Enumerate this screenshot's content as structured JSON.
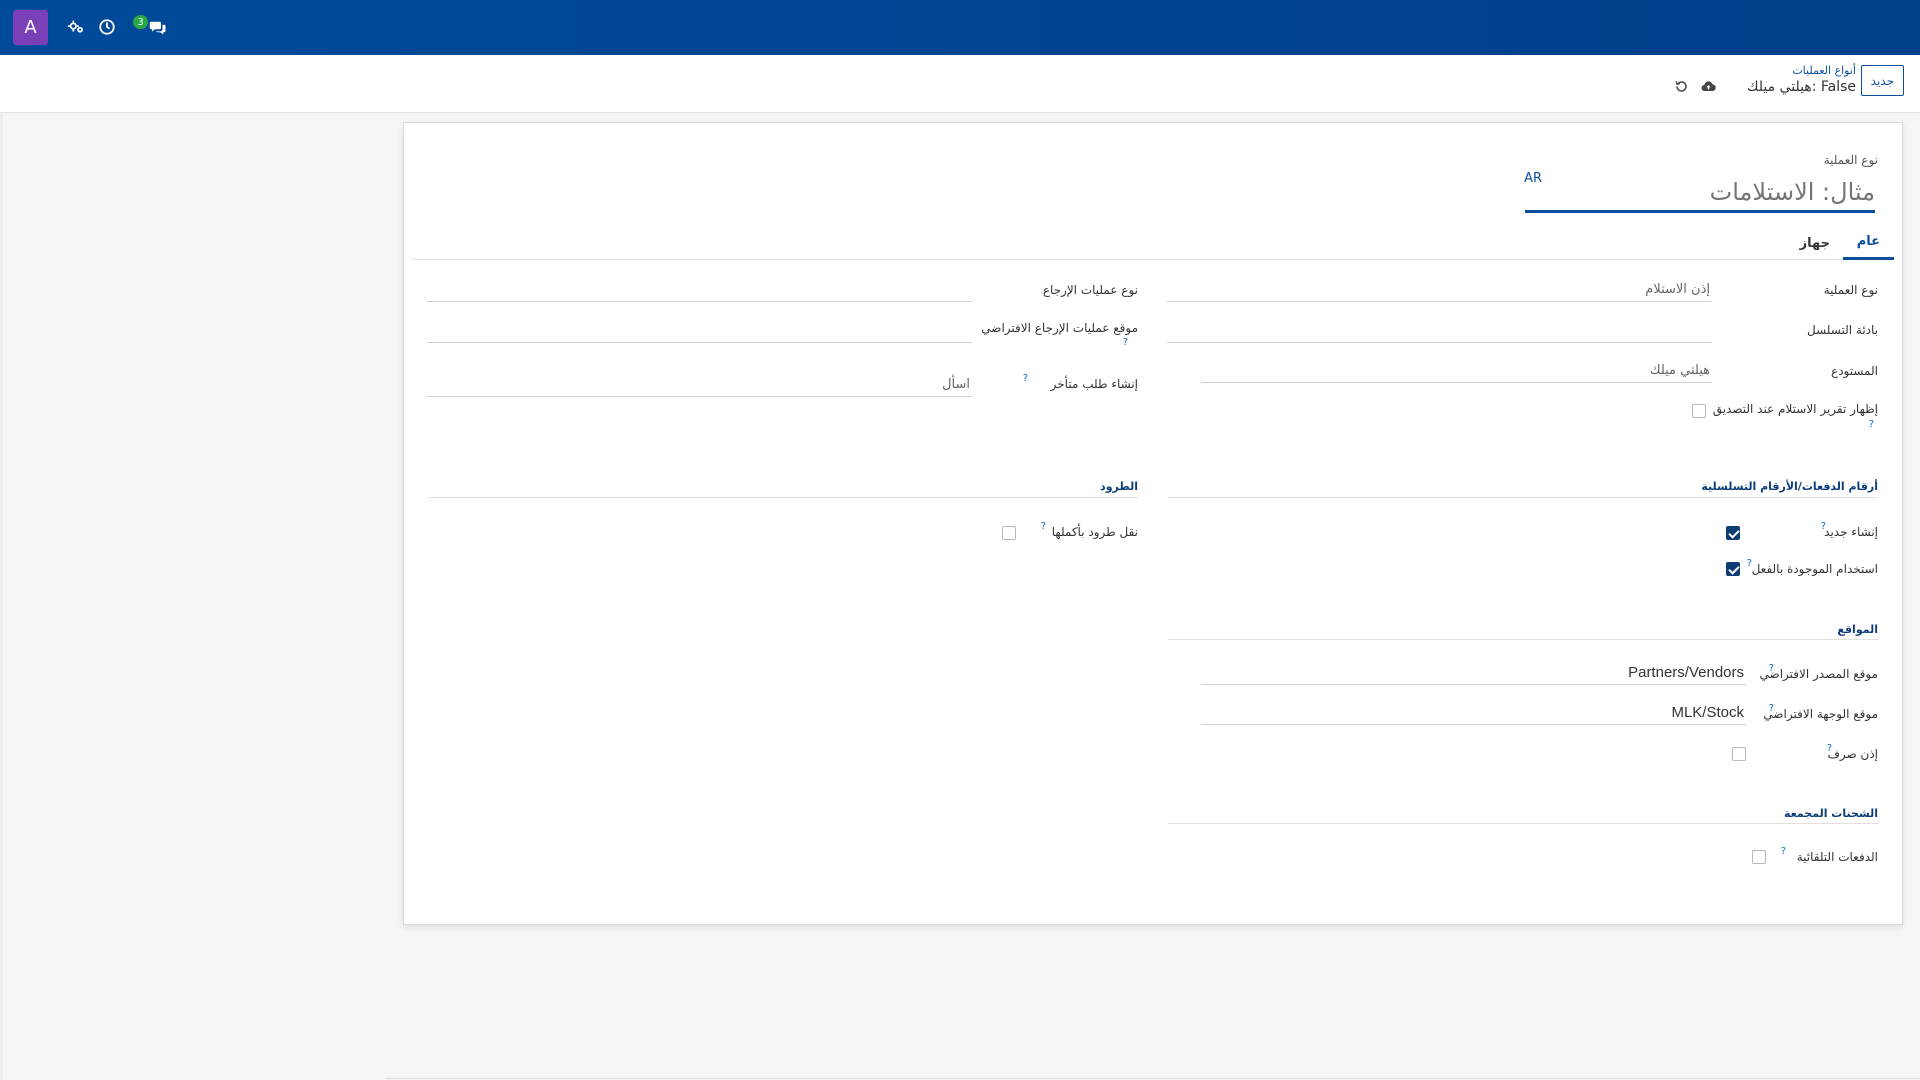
{
  "navbar": {
    "avatar_letter": "A",
    "messages_badge": "3",
    "icons": [
      "settings-gears-icon",
      "clock-icon",
      "chat-icon"
    ]
  },
  "control_panel": {
    "new_button": "جديد",
    "breadcrumb_parent": "أنواع العمليات",
    "breadcrumb_current": "هيلتي ميلك: False",
    "icons": [
      "cloud-upload-icon",
      "discard-icon"
    ]
  },
  "form": {
    "title_label": "نوع العملية",
    "title_placeholder": "مثال: الاستلامات",
    "lang_button": "AR",
    "tabs": [
      {
        "label": "عام",
        "active": true
      },
      {
        "label": "جهاز",
        "active": false
      }
    ],
    "right": {
      "operation_type_label": "نوع العملية",
      "operation_type_value": "إذن الاستلام",
      "sequence_prefix_label": "بادئة التسلسل",
      "sequence_prefix_value": "",
      "warehouse_label": "المستودع",
      "warehouse_value": "هيلتي ميلك",
      "print_label_label": "إظهار تقرير الاستلام عند التصديق",
      "print_label_checked": false
    },
    "left": {
      "return_type_label": "نوع عمليات الإرجاع",
      "return_type_value": "",
      "default_return_location_label": "موقع عمليات الإرجاع الافتراضي",
      "default_return_location_value": "",
      "create_backorder_label": "إنشاء طلب متأخر",
      "create_backorder_value": "اسأل"
    },
    "lots_section": {
      "title": "أرقام الدفعات/الأرقام التسلسلية",
      "create_new_label": "إنشاء جديد",
      "create_new_checked": true,
      "use_existing_label": "استخدام الموجودة بالفعل",
      "use_existing_checked": true
    },
    "packages_section": {
      "title": "الطرود",
      "move_entire_label": "نقل طرود بأكملها",
      "move_entire_checked": false
    },
    "locations_section": {
      "title": "المواقع",
      "default_src_label": "موقع المصدر الافتراضي",
      "default_src_value": "Partners/Vendors",
      "default_dest_label": "موقع الوجهة الافتراضي",
      "default_dest_value": "MLK/Stock",
      "delivery_slip_label": "إذن صرف",
      "delivery_slip_checked": false
    },
    "batch_section": {
      "title": "الشحنات المجمعة",
      "auto_batch_label": "الدفعات التلقائية",
      "auto_batch_checked": false
    },
    "help_mark": "?"
  },
  "colors": {
    "navbar": "#004a9a",
    "accent": "#0b4f9c",
    "avatar": "#7b3fb8",
    "badge": "#28a745",
    "checkbox_on": "#0d3d72"
  }
}
